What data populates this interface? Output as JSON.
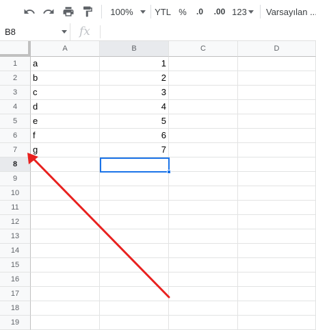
{
  "toolbar": {
    "zoom": "100%",
    "currency": "YTL",
    "percent": "%",
    "decrease_decimal": ".0",
    "increase_decimal": ".00",
    "more_formats": "123",
    "font": "Varsayılan ..."
  },
  "formula_bar": {
    "name_box": "B8",
    "fx_label": "fx",
    "value": ""
  },
  "grid": {
    "columns": [
      "A",
      "B",
      "C",
      "D"
    ],
    "rows": [
      "1",
      "2",
      "3",
      "4",
      "5",
      "6",
      "7",
      "8",
      "9",
      "10",
      "11",
      "12",
      "13",
      "14",
      "15",
      "16",
      "17",
      "18",
      "19"
    ],
    "cells": {
      "A": [
        "a",
        "b",
        "c",
        "d",
        "e",
        "f",
        "g"
      ],
      "B": [
        "1",
        "2",
        "3",
        "4",
        "5",
        "6",
        "7"
      ]
    },
    "selected_cell": "B8"
  },
  "annotation": {
    "type": "arrow",
    "color": "#e8211f",
    "points_to": "row-header-7"
  }
}
